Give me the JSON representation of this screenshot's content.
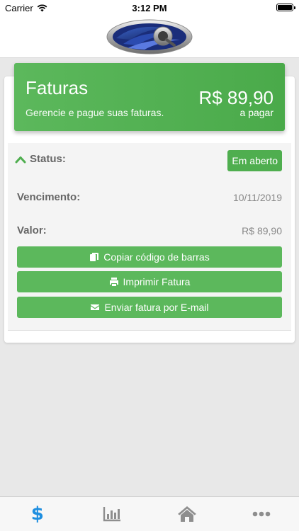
{
  "status_bar": {
    "carrier": "Carrier",
    "time": "3:12 PM"
  },
  "invoice_header": {
    "title": "Faturas",
    "subtitle": "Gerencie e pague suas faturas.",
    "amount": "R$ 89,90",
    "amount_label": "a pagar"
  },
  "details": {
    "status_label": "Status:",
    "status_value": "Em aberto",
    "due_label": "Vencimento:",
    "due_value": "10/11/2019",
    "value_label": "Valor:",
    "value_value": "R$ 89,90"
  },
  "actions": {
    "copy_barcode": "Copiar código de barras",
    "print_invoice": "Imprimir Fatura",
    "email_invoice": "Enviar fatura por E-mail"
  },
  "tabs": [
    {
      "icon": "dollar-icon",
      "active": true
    },
    {
      "icon": "bar-chart-icon",
      "active": false
    },
    {
      "icon": "home-icon",
      "active": false
    },
    {
      "icon": "more-icon",
      "active": false
    }
  ],
  "colors": {
    "accent_green": "#5cb85c",
    "active_tab": "#1f8fe0",
    "inactive_tab": "#8e8e8e"
  }
}
